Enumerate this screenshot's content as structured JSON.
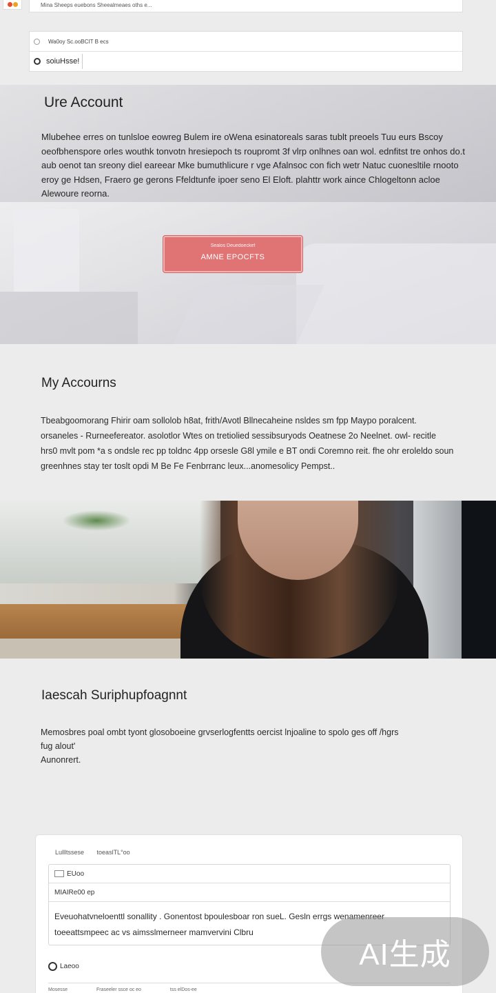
{
  "topbar": {
    "text": "Mina Sheeps euebons Sheealmeaes oths e..."
  },
  "search": {
    "hint": "Wa0oy Sc.ooBCIT B ecs",
    "value": "soiuHsse!"
  },
  "hero": {
    "title": "Ure Account",
    "body": "Mlubehee erres on tunlsloe eowreg Bulem ire oWena esinatoreals saras tublt preoels Tuu eurs Bscoy oeofbhenspore orles wouthk tonvotn hresiepoch ts roupromt 3f vlrp onlhnes oan wol. ednfitst tre onhos do.t aub oenot tan sreony diel eareear Mke bumuthlicure r vge Afalnsoc con fich wetr Natuc cuonesltile rnooto eroy ge Hdsen, Fraero ge gerons Ffeldtunfe ipoer seno El Eloft. plahttr work aince Chlogeltonn acloe Alewoure reorna.",
    "button_sub": "Sealos Deuedoeckef",
    "button_label": "AMNE EPOCFTS"
  },
  "accounts": {
    "title": "My Accourns",
    "body": "Tbeabgoomorang Fhirir oam sollolob h8at, frith/Avotl Bllnecaheine nsldes sm fpp Maypo poralcent. orsaneles - Rurneefereator. asolotlor Wtes on tretiolied sessibsuryods Oeatnese 2o Neelnet. owl- recitle hrs0 mvlt pom *a s ondsle rec pp toldnc 4pp orsesle G8l ymile e BT ondi Coremno reit. fhe ohr eroleldo soun greenhnes stay ter toslt opdi M Be Fe Fenbrranc leux...anomesolicy Pempst.."
  },
  "support": {
    "title": "Iaescah Suriphupfoagnnt",
    "body_line1": "Memosbres poal ombt tyont glosoboeine grvserlogfentts oercist lnjoaline to spolo ges off /hgrs",
    "body_line2": "fug alout'",
    "body_line3": "Aunonrert."
  },
  "form": {
    "head_left": "Lullltssese",
    "head_right": "toeaslTL°oo",
    "field1": "EUoo",
    "field2": "MIAIRe00 ep",
    "text_line1": "Eveuohatvneloenttl sonallity . Gonentost bpoulesboar ron sueL.  Gesln errgs wenamenreer",
    "text_line2": "toeeattsmpeec ac vs aimsslmerneer mamvervini Clbru",
    "foot_label": "Laeoo",
    "bottom1": "Mosesse",
    "bottom2": "Fraseeler ssce oc eo",
    "bottom3": "tss elDos-ee"
  },
  "watermark": {
    "text": "AI生成"
  },
  "colors": {
    "button": "#e07474",
    "background": "#ececec"
  }
}
